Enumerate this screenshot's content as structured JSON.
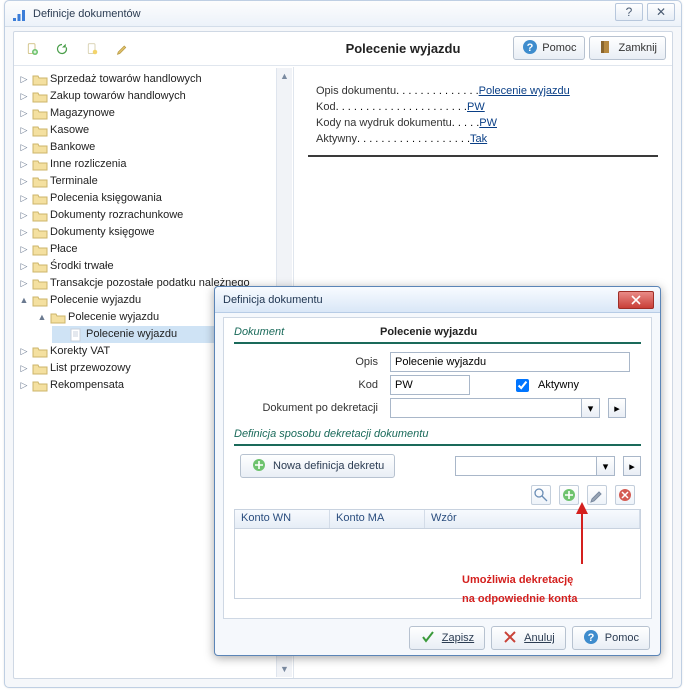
{
  "outer": {
    "title": "Definicje dokumentów",
    "help_btn": "?",
    "close_btn": "✕",
    "panel_title": "Polecenie wyjazdu",
    "help_label": "Pomoc",
    "close_label": "Zamknij"
  },
  "tree": {
    "items": [
      {
        "label": "Sprzedaż towarów handlowych",
        "expander": "▷"
      },
      {
        "label": "Zakup towarów handlowych",
        "expander": "▷"
      },
      {
        "label": "Magazynowe",
        "expander": "▷"
      },
      {
        "label": "Kasowe",
        "expander": "▷"
      },
      {
        "label": "Bankowe",
        "expander": "▷"
      },
      {
        "label": "Inne rozliczenia",
        "expander": "▷"
      },
      {
        "label": "Terminale",
        "expander": "▷"
      },
      {
        "label": "Polecenia księgowania",
        "expander": "▷"
      },
      {
        "label": "Dokumenty rozrachunkowe",
        "expander": "▷"
      },
      {
        "label": "Dokumenty księgowe",
        "expander": "▷"
      },
      {
        "label": "Płace",
        "expander": "▷"
      },
      {
        "label": "Środki trwałe",
        "expander": "▷"
      },
      {
        "label": "Transakcje pozostałe podatku należnego",
        "expander": "▷"
      },
      {
        "label": "Polecenie wyjazdu",
        "expander": "▲",
        "expanded": true,
        "children": [
          {
            "label": "Polecenie wyjazdu",
            "expander": "▲",
            "expanded": true,
            "children": [
              {
                "label": "Polecenie wyjazdu",
                "expander": "",
                "selected": true
              }
            ]
          }
        ]
      },
      {
        "label": "Korekty VAT",
        "expander": "▷"
      },
      {
        "label": "List przewozowy",
        "expander": "▷"
      },
      {
        "label": "Rekompensata",
        "expander": "▷"
      }
    ]
  },
  "detail": {
    "rows": [
      {
        "label": "Opis dokumentu",
        "dots": " . . . . . . . . . . . . . .",
        "value": "Polecenie wyjazdu"
      },
      {
        "label": "Kod",
        "dots": ". . . . . . . . . . . . . . . . . . . . . .",
        "value": "PW"
      },
      {
        "label": "Kody na wydruk dokumentu",
        "dots": " . . . . .",
        "value": "PW"
      },
      {
        "label": "Aktywny",
        "dots": " . . . . . . . . . . . . . . . . . . .",
        "value": "Tak"
      }
    ]
  },
  "dialog": {
    "title": "Definicja dokumentu",
    "section1": "Dokument",
    "section1_value": "Polecenie wyjazdu",
    "opis_label": "Opis",
    "opis_value": "Polecenie wyjazdu",
    "kod_label": "Kod",
    "kod_value": "PW",
    "aktywny_label": "Aktywny",
    "aktywny_checked": true,
    "post_dekret_label": "Dokument po dekretacji",
    "post_dekret_value": "",
    "section2": "Definicja sposobu dekretacji dokumentu",
    "new_def_btn": "Nowa definicja dekretu",
    "combo_value": "",
    "grid_cols": [
      "Konto WN",
      "Konto MA",
      "Wzór"
    ],
    "save_btn": "Zapisz",
    "cancel_btn": "Anuluj",
    "help_btn": "Pomoc"
  },
  "annotation": {
    "line1": "Umożliwia dekretację",
    "line2": "na odpowiednie konta"
  },
  "icons": {
    "help": "help-icon",
    "close": "close-icon",
    "add_doc": "add-doc-icon",
    "plus": "plus-icon",
    "edit": "edit-icon",
    "delete": "delete-icon",
    "zoom": "zoom-icon",
    "check_green": "check-icon",
    "cancel_red": "cancel-icon",
    "dropdown": "dropdown-icon",
    "folder": "folder-icon",
    "doc": "doc-icon"
  }
}
